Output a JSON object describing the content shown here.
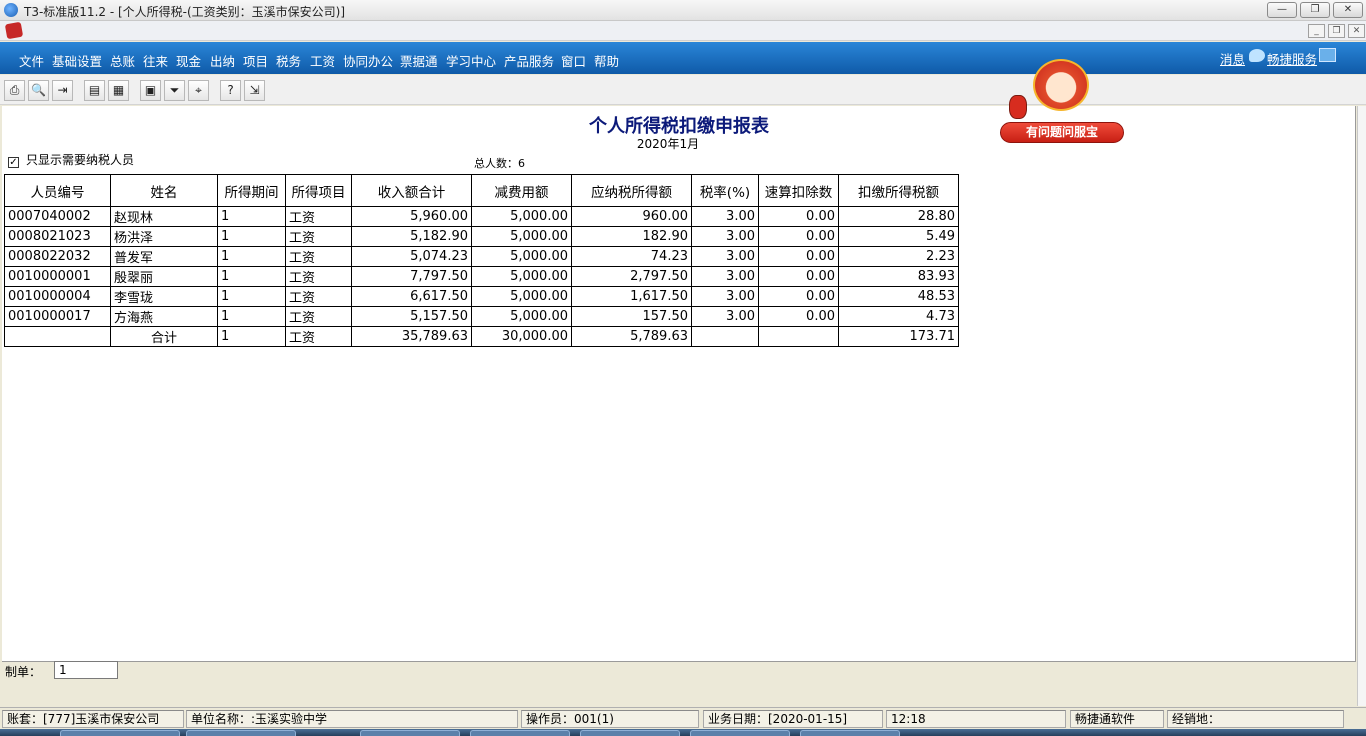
{
  "window": {
    "title": "T3-标准版11.2 - [个人所得税-(工资类别：玉溪市保安公司)]",
    "controls": [
      "—",
      "❐",
      "✕"
    ]
  },
  "mdi": {
    "controls": [
      "_",
      "❐",
      "✕"
    ]
  },
  "menu": {
    "items": [
      "文件",
      "基础设置",
      "总账",
      "往来",
      "现金",
      "出纳",
      "项目",
      "税务",
      "工资",
      "协同办公",
      "票据通",
      "学习中心",
      "产品服务",
      "窗口",
      "帮助"
    ],
    "message_label": "消息",
    "service_label": "畅捷服务"
  },
  "toolbar": {
    "buttons": [
      {
        "icon": "print-icon",
        "glyph": "⎙"
      },
      {
        "icon": "preview-icon",
        "glyph": "🔍"
      },
      {
        "icon": "export-icon",
        "glyph": "⇥"
      },
      {
        "icon": "column-icon",
        "glyph": "▤"
      },
      {
        "icon": "grid-icon",
        "glyph": "▦"
      },
      {
        "icon": "format-icon",
        "glyph": "▣"
      },
      {
        "icon": "filter-icon",
        "glyph": "⏷"
      },
      {
        "icon": "locate-icon",
        "glyph": "⌖"
      },
      {
        "icon": "help-icon",
        "glyph": "?"
      },
      {
        "icon": "exit-icon",
        "glyph": "⇲"
      }
    ]
  },
  "mascot": {
    "badge_label": "有问题问服宝"
  },
  "report": {
    "title": "个人所得税扣缴申报表",
    "period": "2020年1月",
    "filter_label": "只显示需要纳税人员",
    "filter_checked": true,
    "check_mark": "✓",
    "headcount": "总人数：6",
    "columns": [
      "人员编号",
      "姓名",
      "所得期间",
      "所得项目",
      "收入额合计",
      "减费用额",
      "应纳税所得额",
      "税率(%)",
      "速算扣除数",
      "扣缴所得税额"
    ],
    "rows": [
      [
        "0007040002",
        "赵现林",
        "1",
        "工资",
        "5,960.00",
        "5,000.00",
        "960.00",
        "3.00",
        "0.00",
        "28.80"
      ],
      [
        "0008021023",
        "杨洪泽",
        "1",
        "工资",
        "5,182.90",
        "5,000.00",
        "182.90",
        "3.00",
        "0.00",
        "5.49"
      ],
      [
        "0008022032",
        "普发军",
        "1",
        "工资",
        "5,074.23",
        "5,000.00",
        "74.23",
        "3.00",
        "0.00",
        "2.23"
      ],
      [
        "0010000001",
        "殷翠丽",
        "1",
        "工资",
        "7,797.50",
        "5,000.00",
        "2,797.50",
        "3.00",
        "0.00",
        "83.93"
      ],
      [
        "0010000004",
        "李雪珑",
        "1",
        "工资",
        "6,617.50",
        "5,000.00",
        "1,617.50",
        "3.00",
        "0.00",
        "48.53"
      ],
      [
        "0010000017",
        "方海燕",
        "1",
        "工资",
        "5,157.50",
        "5,000.00",
        "157.50",
        "3.00",
        "0.00",
        "4.73"
      ]
    ],
    "total_row": [
      "",
      "合计",
      "1",
      "工资",
      "35,789.63",
      "30,000.00",
      "5,789.63",
      "",
      "",
      "173.71"
    ]
  },
  "maker": {
    "label": "制单：",
    "value": "1"
  },
  "status": {
    "account": "账套：[777]玉溪市保安公司",
    "unit": "单位名称：:玉溪实验中学",
    "operator": "操作员：001(1)",
    "biz_date": "业务日期：[2020-01-15]",
    "time": "12:18",
    "vendor": "畅捷通软件",
    "dealer": "经销地："
  }
}
